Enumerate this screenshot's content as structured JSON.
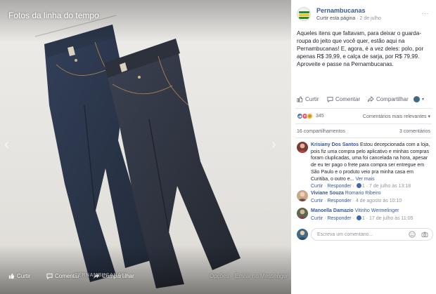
{
  "viewer": {
    "title": "Fotos da linha do tempo",
    "watermark": "PERNAMBUCANAS",
    "actions": {
      "like": "Curtir",
      "comment": "Comentar",
      "share": "Compartilhar",
      "options": "Opções",
      "send_messenger": "Enviar no Messenger"
    }
  },
  "post": {
    "page_name": "Pernambucanas",
    "like_page": "Curtir esta página",
    "separator": "·",
    "date": "2 de julho",
    "more": "···",
    "text": "Aqueles itens que faltavam, para deixar o guarda-roupa do jeito que você quer, estão aqui na Pernambucanas! E, agora, é a vez deles: polo, por apenas R$ 39,99, e calça de sarja, por R$ 79,99. Aproveite e passe na Pernambucanas."
  },
  "actions": {
    "like": "Curtir",
    "comment": "Comentar",
    "share": "Compartilhar"
  },
  "stats": {
    "reaction_count": "345",
    "sort_label": "Comentários mais relevantes ▾",
    "shares": "16 compartilhamentos",
    "comments": "3 comentários"
  },
  "comments": [
    {
      "author": "Krisiany Dos Santos",
      "reply_to": "",
      "text": "Estou decepcionada com a loja, pois fiz uma compra pelo aplicativo e minhas compras foram cluplicadas, uma foi cancelada na hora, apesar de eu ter pago o frete para compra ser entregue em São Paulo e o produto veio pra minha casa em Curitiba, o outro e...",
      "see_more": "Ver mais",
      "like": "Curtir",
      "reply": "Responder",
      "reactions": "1",
      "date": "7 de julho às 13:18"
    },
    {
      "author": "Viviane Souza",
      "reply_to": "Romario Ribeiro",
      "text": "",
      "see_more": "",
      "like": "Curtir",
      "reply": "Responder",
      "reactions": "",
      "date": "4 de agosto às 10:10"
    },
    {
      "author": "Manoella Damazio",
      "reply_to": "Vitinho Wermelinger",
      "text": "",
      "see_more": "",
      "like": "Curtir",
      "reply": "Responder",
      "reactions": "1",
      "date": "17 de julho às 11:05"
    }
  ],
  "composer": {
    "placeholder": "Escreva um comentário..."
  },
  "colors": {
    "link": "#365899",
    "meta": "#90949c",
    "brand_green": "#2f8a2a",
    "denim_dark": "#2a3344",
    "denim_mid": "#3a4658"
  }
}
